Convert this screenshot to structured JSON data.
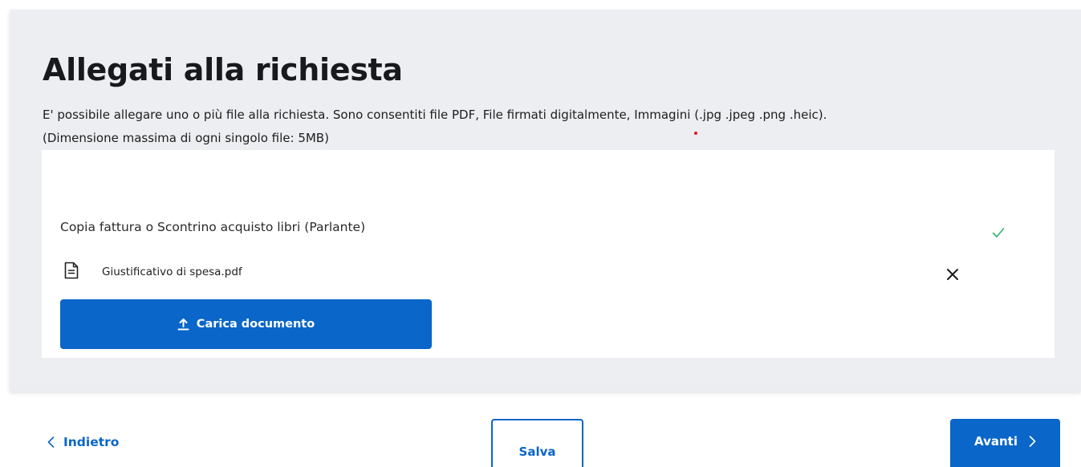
{
  "section": {
    "title": "Allegati alla richiesta",
    "description_line1": "E' possibile allegare uno o più file alla richiesta. Sono consentiti file PDF, File firmati digitalmente, Immagini (.jpg .jpeg .png .heic).",
    "description_line2": "(Dimensione massima di ogni singolo file: 5MB)"
  },
  "attachment": {
    "label": "Copia fattura o Scontrino acquisto libri (Parlante)",
    "status_icon": "check-icon",
    "file_name": "Giustificativo di spesa.pdf",
    "file_icon": "file-icon",
    "remove_icon": "close-icon",
    "upload_label": "Carica documento",
    "upload_icon": "upload-icon"
  },
  "footer": {
    "back_label": "Indietro",
    "save_label": "Salva",
    "next_label": "Avanti"
  },
  "colors": {
    "primary": "#0a66c8",
    "panel_bg": "#eceef1",
    "success": "#2fb36b",
    "marker": "#e0181f"
  }
}
